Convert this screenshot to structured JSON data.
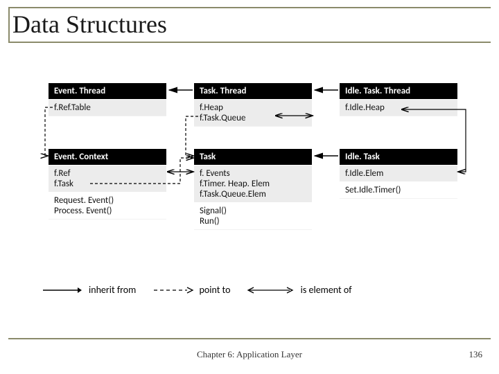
{
  "title": "Data Structures",
  "classes": {
    "eventThread": {
      "name": "Event. Thread",
      "fields": [
        "f.Ref.Table"
      ]
    },
    "taskThread": {
      "name": "Task. Thread",
      "fields": [
        "f.Heap",
        "f.Task.Queue"
      ]
    },
    "idleTaskThread": {
      "name": "Idle. Task. Thread",
      "fields": [
        "f.Idle.Heap"
      ]
    },
    "eventContext": {
      "name": "Event. Context",
      "fields": [
        "f.Ref",
        "f.Task"
      ],
      "methods": [
        "Request. Event()",
        "Process. Event()"
      ]
    },
    "task": {
      "name": "Task",
      "fields": [
        "f. Events",
        "f.Timer. Heap. Elem",
        "f.Task.Queue.Elem"
      ],
      "methods": [
        "Signal()",
        "Run()"
      ]
    },
    "idleTask": {
      "name": "Idle. Task",
      "fields": [
        "f.Idle.Elem"
      ],
      "methods": [
        "Set.Idle.Timer()"
      ]
    }
  },
  "legend": {
    "inherit": "inherit from",
    "point": "point to",
    "element": "is element of"
  },
  "footer": {
    "center": "Chapter 6: Application Layer",
    "pageno": "136"
  }
}
